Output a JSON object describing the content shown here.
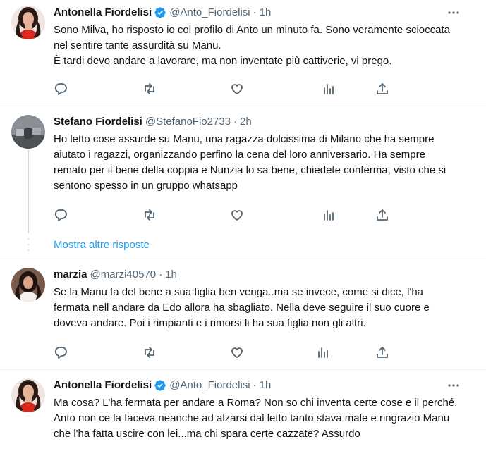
{
  "tweets": [
    {
      "name": "Antonella Fiordelisi",
      "verified": true,
      "handle": "@Anto_Fiordelisi",
      "separator": "·",
      "time": "1h",
      "text": "Sono Milva, ho risposto io col profilo di Anto un minuto fa. Sono veramente scioccata nel sentire tante assurdità su Manu.\nÈ tardi devo andare a lavorare, ma non inventate più cattiverie, vi prego."
    },
    {
      "name": "Stefano Fiordelisi",
      "verified": false,
      "handle": "@StefanoFio2733",
      "separator": "·",
      "time": "2h",
      "text": "Ho letto cose assurde su Manu, una ragazza dolcissima di Milano che ha sempre aiutato i ragazzi, organizzando perfino la cena del loro anniversario. Ha sempre remato per il bene della coppia e Nunzia lo sa bene, chiedete conferma, visto che si sentono spesso in un gruppo whatsapp"
    },
    {
      "name": "marzia",
      "verified": false,
      "handle": "@marzi40570",
      "separator": "·",
      "time": "1h",
      "text": "Se la Manu fa del bene a sua figlia ben venga..ma se invece, come si dice, l'ha fermata nell andare da Edo allora ha sbagliato. Nella deve seguire il suo cuore e doveva andare. Poi i rimpianti e i rimorsi li ha sua figlia non gli altri."
    },
    {
      "name": "Antonella Fiordelisi",
      "verified": true,
      "handle": "@Anto_Fiordelisi",
      "separator": "·",
      "time": "1h",
      "text": "Ma cosa? L'ha fermata per andare a Roma? Non so chi inventa certe cose e il perché. Anto non ce la faceva neanche ad alzarsi dal letto tanto stava male e ringrazio Manu che l'ha fatta uscire con lei...ma chi spara certe cazzate? Assurdo"
    }
  ],
  "show_more_replies": "Mostra altre risposte",
  "icons": {
    "more": "more-icon",
    "reply": "reply-icon",
    "retweet": "retweet-icon",
    "like": "like-icon",
    "views": "views-icon",
    "share": "share-icon",
    "verified": "verified-badge-icon"
  },
  "colors": {
    "link": "#1d9bf0",
    "secondary_text": "#536471",
    "verified": "#1d9bf0",
    "divider": "#eff3f4"
  }
}
